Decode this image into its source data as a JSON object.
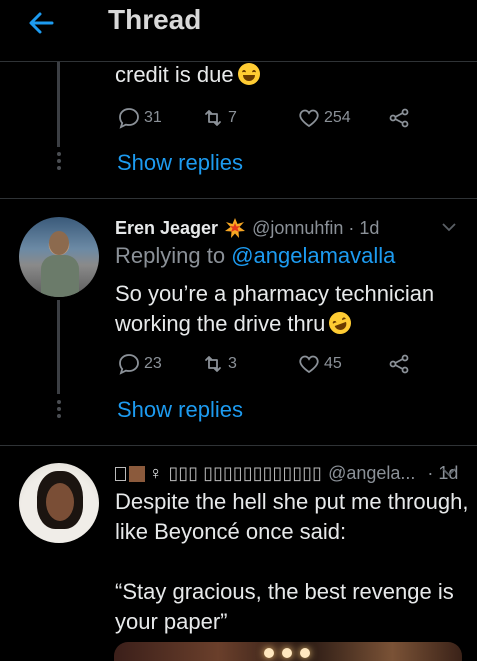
{
  "header": {
    "title": "Thread"
  },
  "tweet1": {
    "text_tail": "credit is due",
    "reply_count": "31",
    "retweet_count": "7",
    "like_count": "254",
    "show_replies": "Show replies"
  },
  "tweet2": {
    "name": "Eren Jeager",
    "handle_time": "@jonnuhfin · 1d",
    "replying_prefix": "Replying to",
    "replying_mention": "@angelamavalla",
    "text_line1": "So you’re a pharmacy technician",
    "text_line2": "working the drive thru",
    "reply_count": "23",
    "retweet_count": "3",
    "like_count": "45",
    "show_replies": "Show replies"
  },
  "tweet3": {
    "name_symbol": "♀",
    "name_boxes": "▯▯▯ ▯▯▯▯▯▯▯▯▯▯▯▯",
    "handle": "@angela...",
    "time": "· 1d",
    "text_line1": "Despite the hell she put me through,",
    "text_line2": "like Beyoncé once said:",
    "text_line3": "“Stay gracious, the best revenge is",
    "text_line4": "your paper”"
  },
  "colors": {
    "accent": "#1d9bf0",
    "muted": "#8b9198",
    "background": "#000000",
    "separator": "#2f3336"
  },
  "icons": [
    "back-arrow-icon",
    "reply-icon",
    "retweet-icon",
    "like-icon",
    "share-icon",
    "chevron-down-icon",
    "explosion-emoji-icon",
    "grinning-emoji-icon",
    "laughing-emoji-icon"
  ]
}
